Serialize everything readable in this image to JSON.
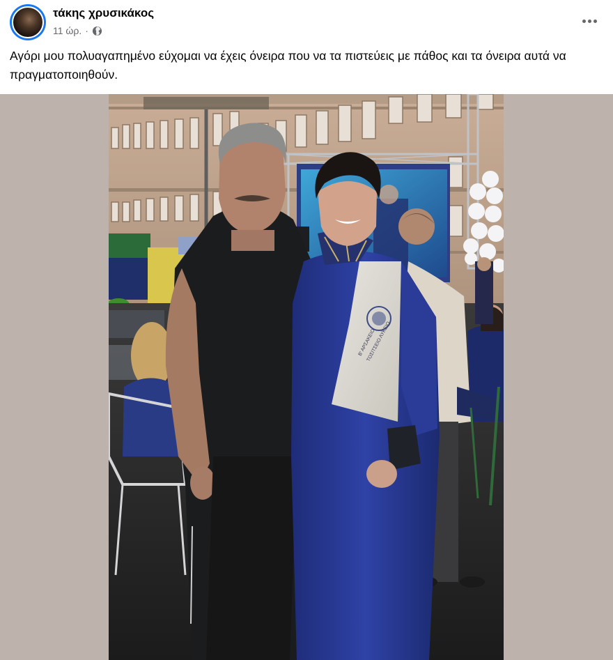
{
  "post": {
    "author": {
      "name": "τάκης χρυσικάκος",
      "avatar_icon": "profile-photo"
    },
    "meta": {
      "time": "11 ώρ.",
      "separator": "·",
      "audience_icon": "globe-icon"
    },
    "more_icon": "more-options-icon",
    "text": "Αγόρι μου πολυαγαπημένο εύχομαι να έχεις όνειρα που να τα πιστεύεις με πάθος και τα όνειρα αυτά να πραγματοποιηθούν.",
    "photo": {
      "stole_text_line1": "Β' ΑΡΣΑΚΕΙΟ",
      "stole_text_line2": "ΤΟΣΙΤΣΕΙΟ ΛΥΚΕΙΟ"
    }
  },
  "colors": {
    "ring": "#1877f2",
    "secondary_text": "#65676b",
    "photo_letterbox": "#bdb3ac"
  }
}
